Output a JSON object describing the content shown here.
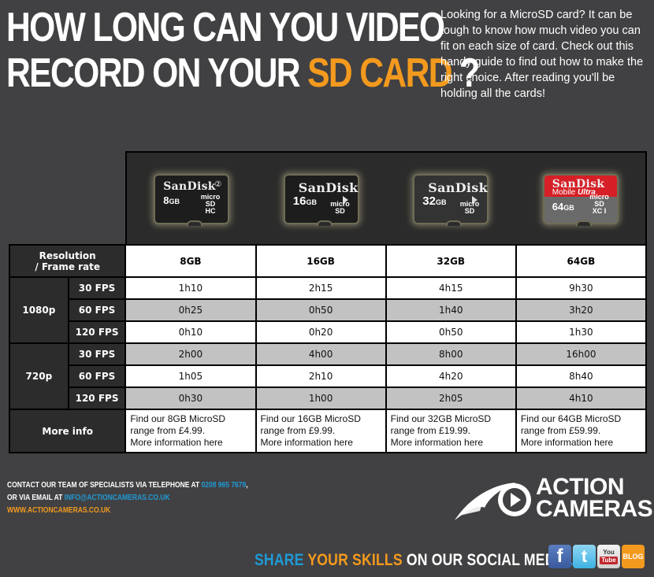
{
  "header": {
    "title_line1": "HOW LONG CAN YOU VIDEO",
    "title_line2_prefix": "RECORD ON YOUR ",
    "title_line2_accent": "SD CARD",
    "title_line2_suffix": " ?",
    "intro": "Looking for a MicroSD card? It can be tough to know how much video you can fit on each size of card. Check out this handy guide to find out how to make the right choice. After reading you'll be holding all the cards!"
  },
  "cards": [
    {
      "brand": "SanDisk",
      "capacity": "8",
      "unit": "GB",
      "logo_top": "micro",
      "logo_mid": "SD",
      "logo_bottom": "HC",
      "class_mark": "②"
    },
    {
      "brand": "SanDisk",
      "capacity": "16",
      "unit": "GB",
      "logo_top": "micro",
      "logo_mid": "SD"
    },
    {
      "brand": "SanDisk",
      "capacity": "32",
      "unit": "GB",
      "logo_top": "micro",
      "logo_mid": "SD"
    },
    {
      "brand": "SanDisk",
      "line": "Mobile",
      "line_accent": "Ultra",
      "capacity": "64",
      "unit": "GB",
      "logo_top": "micro",
      "logo_mid": "SD",
      "logo_bottom": "XC I"
    }
  ],
  "table": {
    "corner_line1": "Resolution",
    "corner_line2": "/ Frame rate",
    "columns": [
      "8GB",
      "16GB",
      "32GB",
      "64GB"
    ],
    "groups": [
      {
        "resolution": "1080p",
        "rows": [
          {
            "fps": "30 FPS",
            "values": [
              "1h10",
              "2h15",
              "4h15",
              "9h30"
            ]
          },
          {
            "fps": "60 FPS",
            "values": [
              "0h25",
              "0h50",
              "1h40",
              "3h20"
            ]
          },
          {
            "fps": "120 FPS",
            "values": [
              "0h10",
              "0h20",
              "0h50",
              "1h30"
            ]
          }
        ]
      },
      {
        "resolution": "720p",
        "rows": [
          {
            "fps": "30 FPS",
            "values": [
              "2h00",
              "4h00",
              "8h00",
              "16h00"
            ]
          },
          {
            "fps": "60 FPS",
            "values": [
              "1h05",
              "2h10",
              "4h20",
              "8h40"
            ]
          },
          {
            "fps": "120 FPS",
            "values": [
              "0h30",
              "1h00",
              "2h05",
              "4h10"
            ]
          }
        ]
      }
    ],
    "more_info_label": "More info",
    "more_info": [
      {
        "line1": "Find our 8GB MicroSD",
        "line2": "range from £4.99.",
        "link": "More information here"
      },
      {
        "line1": "Find our 16GB MicroSD",
        "line2": "range from £9.99.",
        "link": "More information here"
      },
      {
        "line1": "Find our 32GB MicroSD",
        "line2": "range from £19.99.",
        "link": "More information here"
      },
      {
        "line1": "Find our 64GB MicroSD",
        "line2": "range from £59.99.",
        "link": "More information here"
      }
    ]
  },
  "contact": {
    "line1_prefix": "CONTACT OUR TEAM OF SPECIALISTS VIA TELEPHONE AT ",
    "phone": "0208 965 7679",
    "line1_suffix": ",",
    "line2_prefix": "OR VIA EMAIL AT ",
    "email": "INFO@ACTIONCAMERAS.CO.UK",
    "website": "WWW.ACTIONCAMERAS.CO.UK"
  },
  "logo": {
    "line1": "ACTION",
    "line2": "CAMERAS"
  },
  "footer": {
    "share_blue": "SHARE ",
    "share_orange": "YOUR SKILLS ",
    "share_white": "ON OUR SOCIAL MEDIA",
    "share_dot": ".",
    "social": {
      "facebook": "f",
      "twitter": "t",
      "youtube_top": "You",
      "youtube_bottom": "Tube",
      "blog": "BLOG"
    }
  },
  "colors": {
    "accent_orange": "#f39a1e",
    "accent_blue": "#1f9ad6",
    "background": "#414143",
    "row_grey": "#c2c2c2"
  }
}
